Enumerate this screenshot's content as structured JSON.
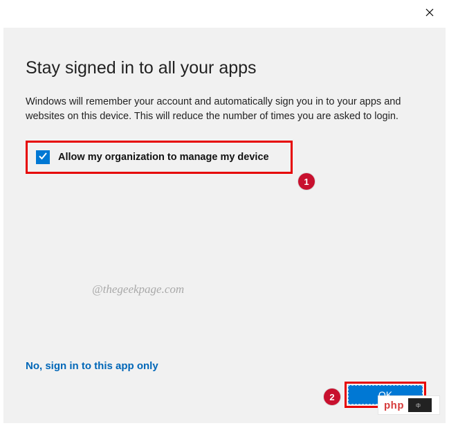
{
  "title": "Stay signed in to all your apps",
  "description": "Windows will remember your account and automatically sign you in to your apps and websites on this device. This will reduce the number of times you are asked to login.",
  "checkbox": {
    "checked": true,
    "label": "Allow my organization to manage my device"
  },
  "watermark": "@thegeekpage.com",
  "alt_link": "No, sign in to this app only",
  "ok_label": "OK",
  "annotations": [
    "1",
    "2"
  ],
  "overlay": {
    "text": "php"
  },
  "colors": {
    "accent": "#0078d4",
    "link": "#0067b8",
    "annotation_red": "#c8102e",
    "frame_red": "#e60000",
    "panel_bg": "#f1f1f1"
  }
}
